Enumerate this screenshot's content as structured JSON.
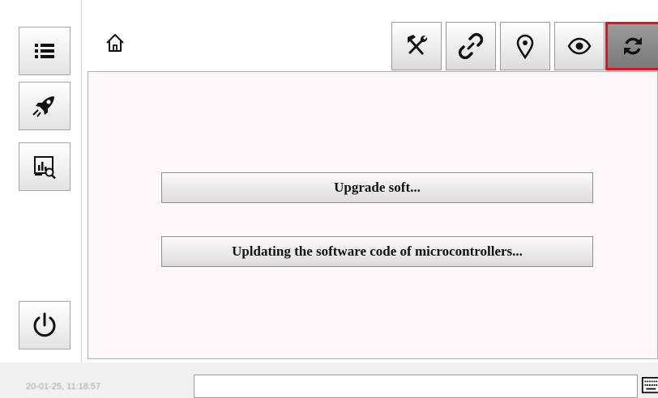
{
  "sidebar": {
    "items": [
      {
        "icon": "list-icon"
      },
      {
        "icon": "rocket-icon"
      },
      {
        "icon": "chart-search-icon"
      },
      {
        "icon": "power-icon"
      }
    ]
  },
  "toolbar": {
    "home_icon": "home-icon",
    "buttons": [
      {
        "icon": "tools-icon"
      },
      {
        "icon": "link-icon"
      },
      {
        "icon": "location-pin-icon"
      },
      {
        "icon": "eye-icon"
      },
      {
        "icon": "refresh-icon",
        "active": true
      }
    ]
  },
  "main": {
    "upgrade_label": "Upgrade soft...",
    "update_label": "Upldating the software code of microcontrollers..."
  },
  "status": {
    "timestamp": "20-01-25, 11:18:57",
    "input_value": "",
    "keyboard_icon": "keyboard-icon"
  },
  "colors": {
    "active_border": "#e3101d",
    "content_background": "#fdf7f9"
  }
}
